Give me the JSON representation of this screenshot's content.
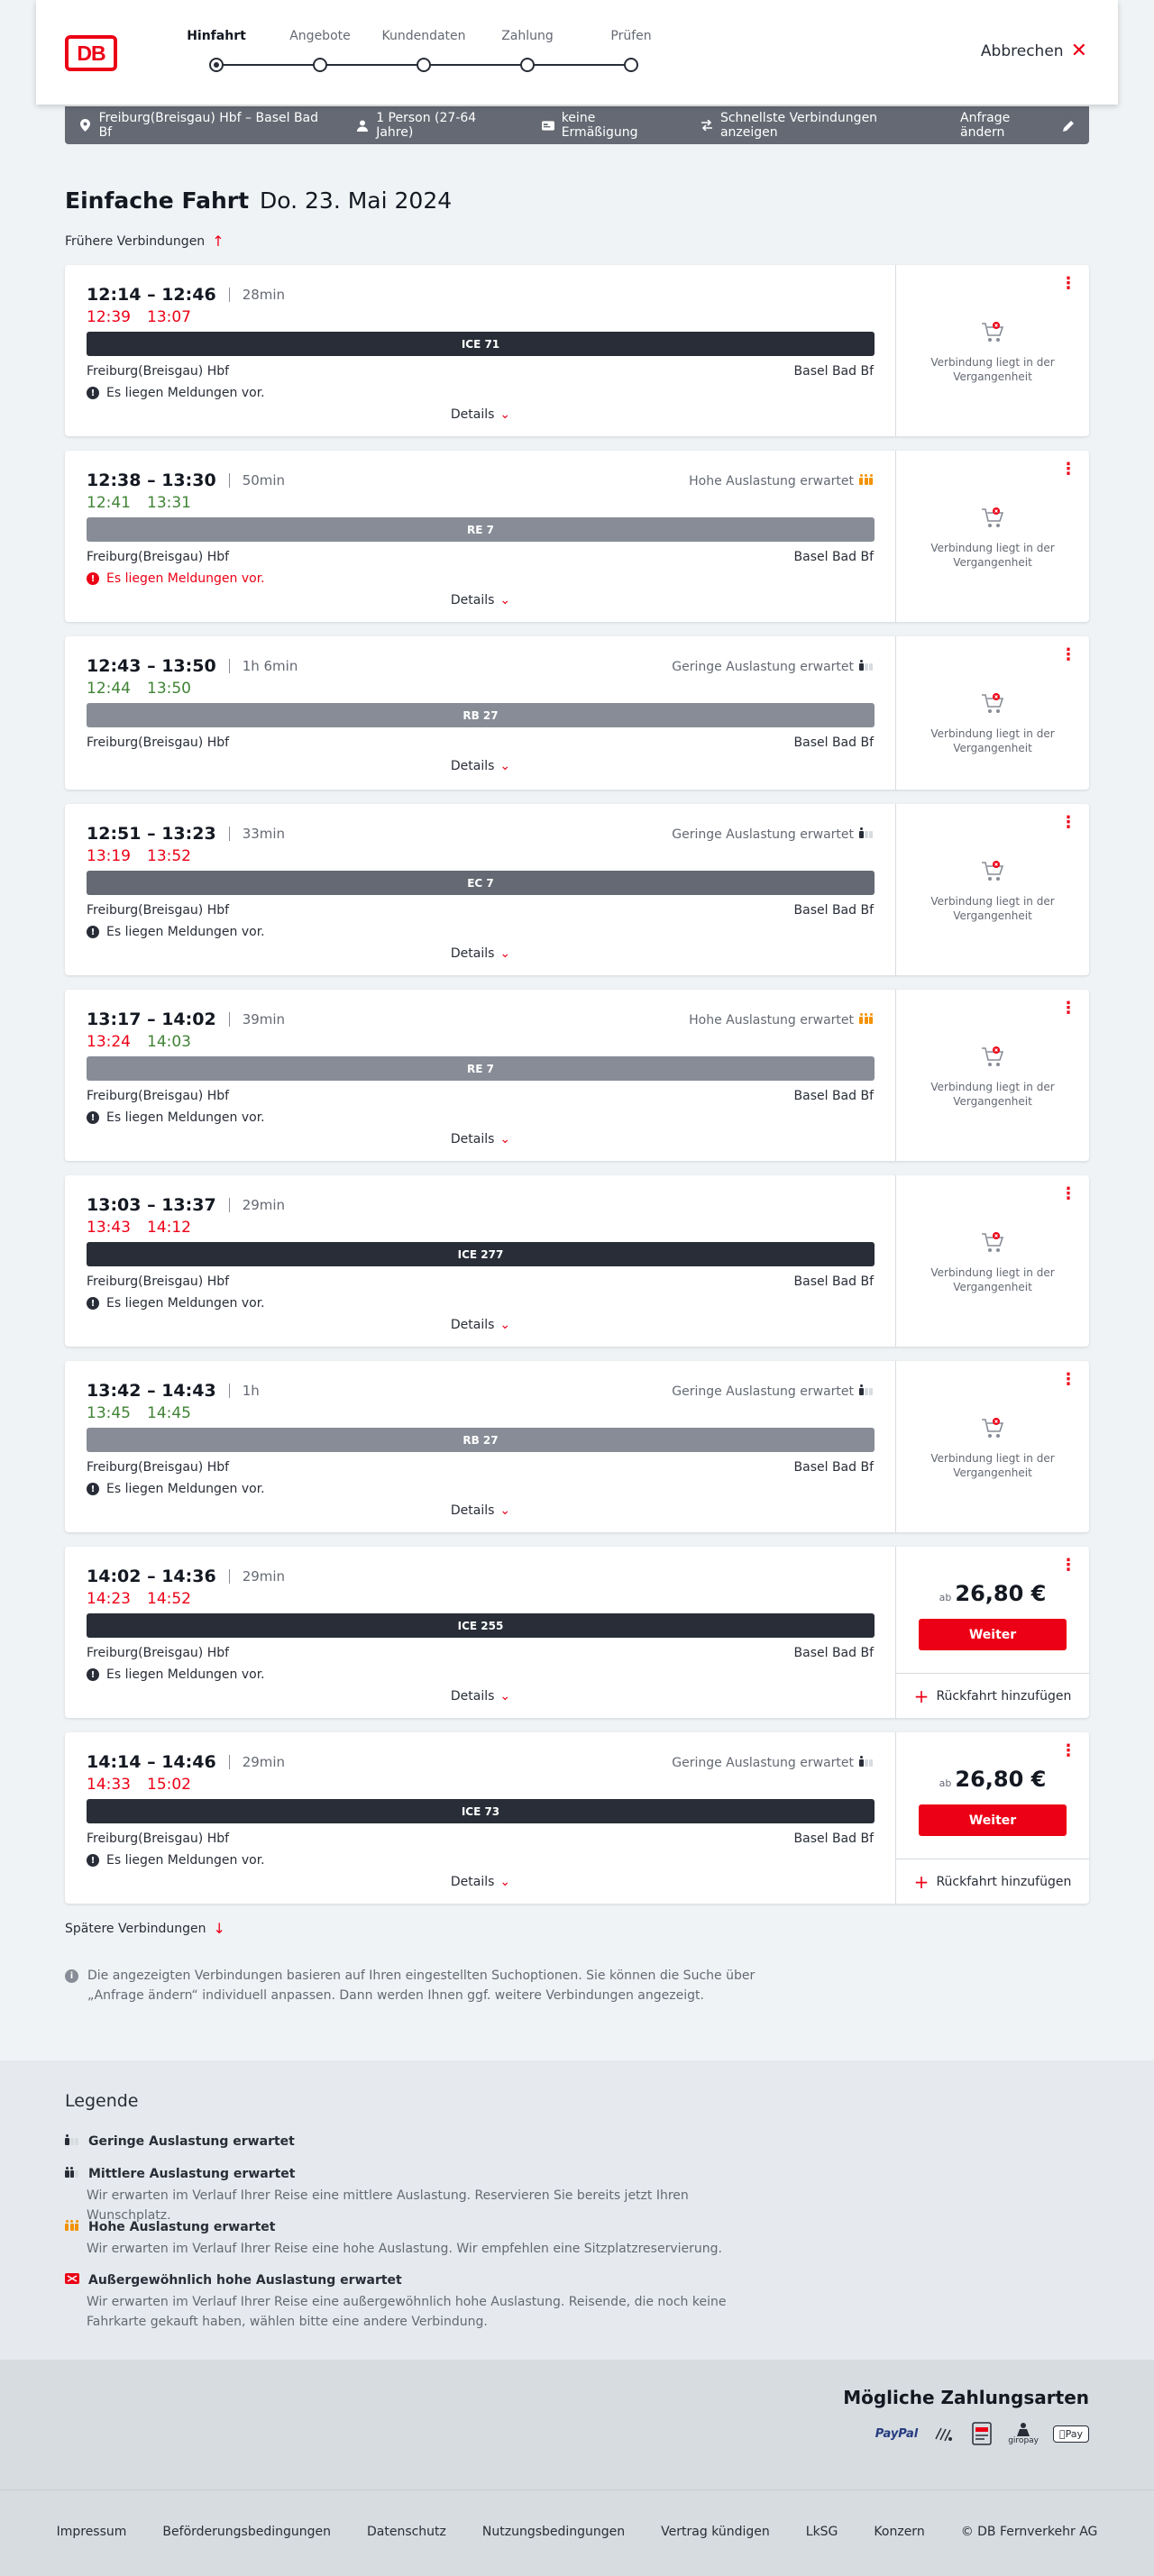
{
  "header": {
    "logo": "DB",
    "steps": [
      {
        "label": "Hinfahrt"
      },
      {
        "label": "Angebote"
      },
      {
        "label": "Kundendaten"
      },
      {
        "label": "Zahlung"
      },
      {
        "label": "Prüfen"
      }
    ],
    "active_step": "Hinfahrt",
    "cancel_label": "Abbrechen"
  },
  "request": {
    "route": "Freiburg(Breisgau) Hbf – Basel Bad Bf",
    "passengers": "1 Person (27-64 Jahre)",
    "discount": "keine Ermäßigung",
    "fastest": "Schnellste Verbindungen anzeigen",
    "change_label": "Anfrage ändern"
  },
  "title": {
    "trip_type": "Einfache Fahrt",
    "date": "Do. 23. Mai 2024"
  },
  "earlier_label": "Frühere Verbindungen",
  "later_label": "Spätere Verbindungen",
  "details_label": "Details",
  "past_label": "Verbindung liegt in der Vergangenheit",
  "price_prefix": "ab",
  "weiter_label": "Weiter",
  "return_label": "Rückfahrt hinzufügen",
  "connections": [
    {
      "times": "12:14 – 12:46",
      "duration": "28min",
      "rt_dep": "12:39",
      "rt_arr": "13:07",
      "rt_status": "late",
      "load": "",
      "train": "ICE 71",
      "train_kind": "ice",
      "from": "Freiburg(Breisgau) Hbf",
      "to": "Basel Bad Bf",
      "message": "Es liegen Meldungen vor.",
      "message_red": false,
      "price": ""
    },
    {
      "times": "12:38 – 13:30",
      "duration": "50min",
      "rt_dep": "12:41",
      "rt_arr": "13:31",
      "rt_status": "ok",
      "load": "Hohe Auslastung erwartet",
      "load_level": "high",
      "train": "RE 7",
      "train_kind": "reg",
      "from": "Freiburg(Breisgau) Hbf",
      "to": "Basel Bad Bf",
      "message": "Es liegen Meldungen vor.",
      "message_red": true,
      "price": ""
    },
    {
      "times": "12:43 – 13:50",
      "duration": "1h 6min",
      "rt_dep": "12:44",
      "rt_arr": "13:50",
      "rt_status": "ok",
      "load": "Geringe Auslastung erwartet",
      "load_level": "low",
      "train": "RB 27",
      "train_kind": "reg",
      "from": "Freiburg(Breisgau) Hbf",
      "to": "Basel Bad Bf",
      "message": "",
      "message_red": false,
      "price": ""
    },
    {
      "times": "12:51 – 13:23",
      "duration": "33min",
      "rt_dep": "13:19",
      "rt_arr": "13:52",
      "rt_status": "late",
      "load": "Geringe Auslastung erwartet",
      "load_level": "low",
      "train": "EC 7",
      "train_kind": "ec",
      "from": "Freiburg(Breisgau) Hbf",
      "to": "Basel Bad Bf",
      "message": "Es liegen Meldungen vor.",
      "message_red": false,
      "price": ""
    },
    {
      "times": "13:17 – 14:02",
      "duration": "39min",
      "rt_dep": "13:24",
      "rt_arr": "14:03",
      "rt_status": "mixed",
      "load": "Hohe Auslastung erwartet",
      "load_level": "high",
      "train": "RE 7",
      "train_kind": "reg",
      "from": "Freiburg(Breisgau) Hbf",
      "to": "Basel Bad Bf",
      "message": "Es liegen Meldungen vor.",
      "message_red": false,
      "price": ""
    },
    {
      "times": "13:03 – 13:37",
      "duration": "29min",
      "rt_dep": "13:43",
      "rt_arr": "14:12",
      "rt_status": "late",
      "load": "",
      "train": "ICE 277",
      "train_kind": "ice",
      "from": "Freiburg(Breisgau) Hbf",
      "to": "Basel Bad Bf",
      "message": "Es liegen Meldungen vor.",
      "message_red": false,
      "price": ""
    },
    {
      "times": "13:42 – 14:43",
      "duration": "1h",
      "rt_dep": "13:45",
      "rt_arr": "14:45",
      "rt_status": "ok",
      "load": "Geringe Auslastung erwartet",
      "load_level": "low",
      "train": "RB 27",
      "train_kind": "reg",
      "from": "Freiburg(Breisgau) Hbf",
      "to": "Basel Bad Bf",
      "message": "Es liegen Meldungen vor.",
      "message_red": false,
      "price": ""
    },
    {
      "times": "14:02 – 14:36",
      "duration": "29min",
      "rt_dep": "14:23",
      "rt_arr": "14:52",
      "rt_status": "late",
      "load": "",
      "train": "ICE 255",
      "train_kind": "ice",
      "from": "Freiburg(Breisgau) Hbf",
      "to": "Basel Bad Bf",
      "message": "Es liegen Meldungen vor.",
      "message_red": false,
      "price": "26,80 €"
    },
    {
      "times": "14:14 – 14:46",
      "duration": "29min",
      "rt_dep": "14:33",
      "rt_arr": "15:02",
      "rt_status": "late",
      "load": "Geringe Auslastung erwartet",
      "load_level": "low",
      "train": "ICE 73",
      "train_kind": "ice",
      "from": "Freiburg(Breisgau) Hbf",
      "to": "Basel Bad Bf",
      "message": "Es liegen Meldungen vor.",
      "message_red": false,
      "price": "26,80 €"
    }
  ],
  "info_note": "Die angezeigten Verbindungen basieren auf Ihren eingestellten Suchoptionen. Sie können die Suche über „Anfrage ändern“ individuell anpassen. Dann werden Ihnen ggf. weitere Verbindungen angezeigt.",
  "legend": {
    "title": "Legende",
    "items": [
      {
        "title": "Geringe Auslastung erwartet",
        "text": "",
        "level": "low"
      },
      {
        "title": "Mittlere Auslastung erwartet",
        "text": "Wir erwarten im Verlauf Ihrer Reise eine mittlere Auslastung. Reservieren Sie bereits jetzt Ihren Wunschplatz.",
        "level": "mid"
      },
      {
        "title": "Hohe Auslastung erwartet",
        "text": "Wir erwarten im Verlauf Ihrer Reise eine hohe Auslastung. Wir empfehlen eine Sitzplatzreservierung.",
        "level": "high"
      },
      {
        "title": "Außergewöhnlich hohe Auslastung erwartet",
        "text": "Wir erwarten im Verlauf Ihrer Reise eine außergewöhnlich hohe Auslastung. Reisende, die noch keine Fahrkarte gekauft haben, wählen bitte eine andere Verbindung.",
        "level": "extreme"
      }
    ]
  },
  "payments": {
    "title": "Mögliche Zahlungsarten",
    "methods": [
      "PayPal",
      "giropay",
      "Pay"
    ]
  },
  "footer": {
    "links": [
      "Impressum",
      "Beförderungsbedingungen",
      "Datenschutz",
      "Nutzungsbedingungen",
      "Vertrag kündigen",
      "LkSG",
      "Konzern",
      "© DB Fernverkehr AG"
    ]
  },
  "colors": {
    "brand": "#ec0016",
    "ontime": "#408335",
    "load_high": "#f39200"
  }
}
